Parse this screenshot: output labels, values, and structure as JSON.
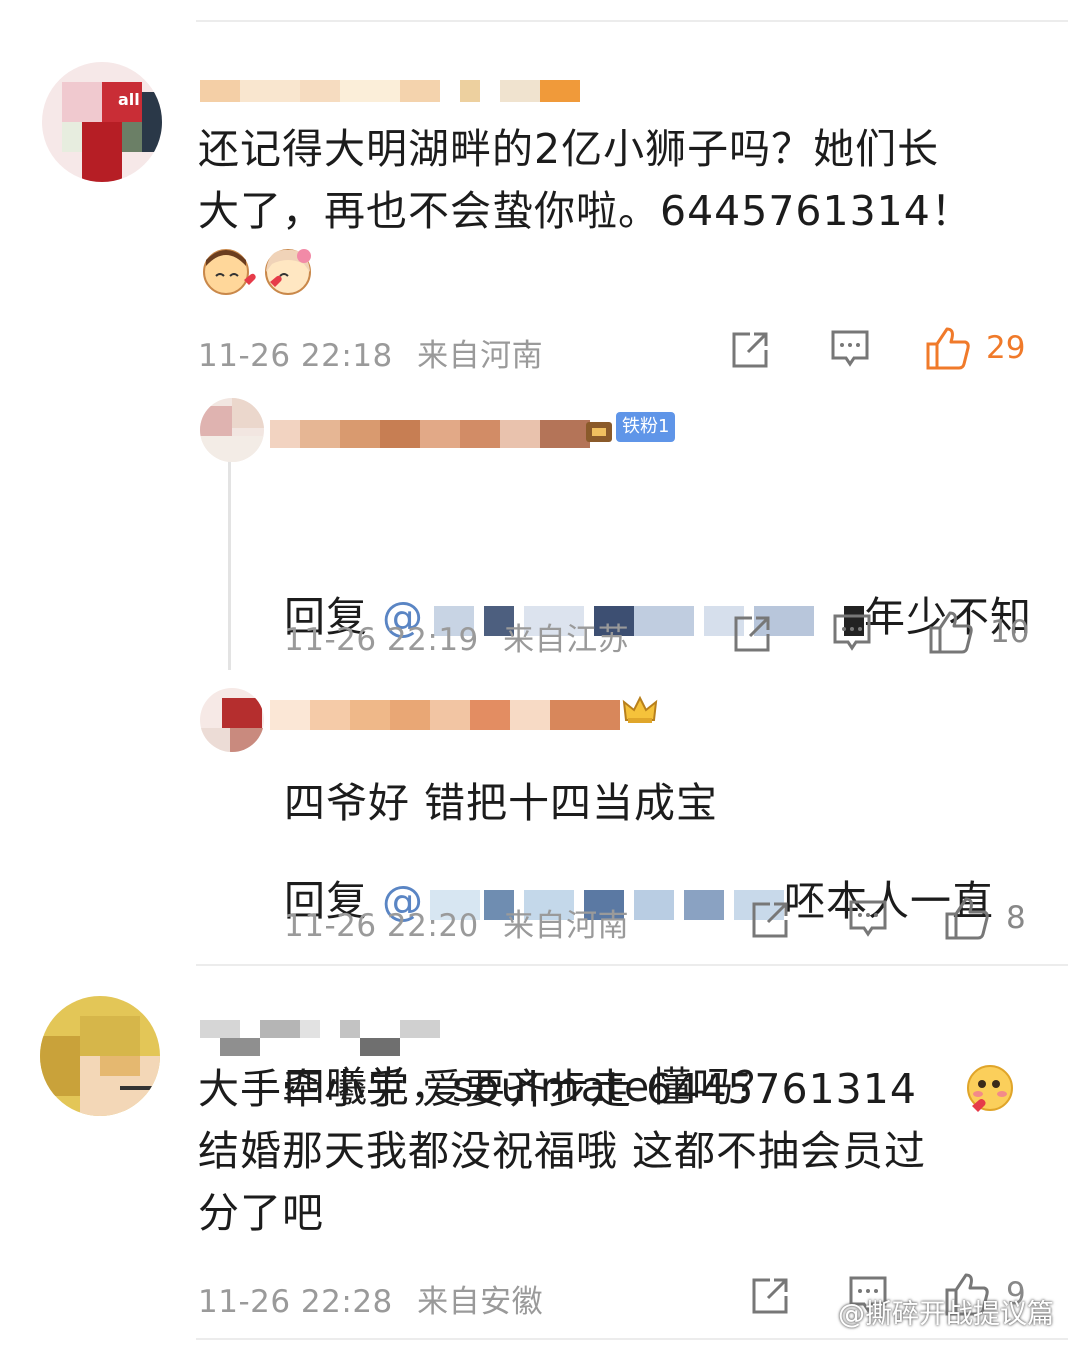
{
  "comments": [
    {
      "text": "还记得大明湖畔的2亿小狮子吗？她们长\n大了，再也不会蛰你啦。6445761314！",
      "time": "11-26 22:18",
      "location": "来自河南",
      "likes": "29",
      "avatar_text": "all"
    },
    {
      "reply_prefix": "回复",
      "mention_at": "@",
      "text_line1_tail": "年少不知",
      "text_line2": "四爷好 错把十四当成宝",
      "badge": "铁粉1",
      "time": "11-26 22:19",
      "location": "来自江苏",
      "likes": "10"
    },
    {
      "reply_prefix": "回复",
      "mention_at": "@",
      "text_line1_tail": "呸本人一直",
      "text_line2": "四曦党，soulmate懂吗？",
      "time": "11-26 22:20",
      "location": "来自河南",
      "likes": "8"
    },
    {
      "text": "大手牵小手 爱要齐步走 6445761314\n结婚那天我都没祝福哦 这都不抽会员过\n分了吧",
      "time": "11-26 22:28",
      "location": "来自安徽",
      "likes": "9"
    }
  ],
  "watermark": "@撕碎开战提议篇",
  "icons": {
    "share": "share-icon",
    "comment": "comment-icon",
    "like": "like-icon"
  },
  "colors": {
    "like_active": "#f07a2a",
    "meta_gray": "#9a9a9a",
    "badge_blue": "#5f95e8"
  }
}
